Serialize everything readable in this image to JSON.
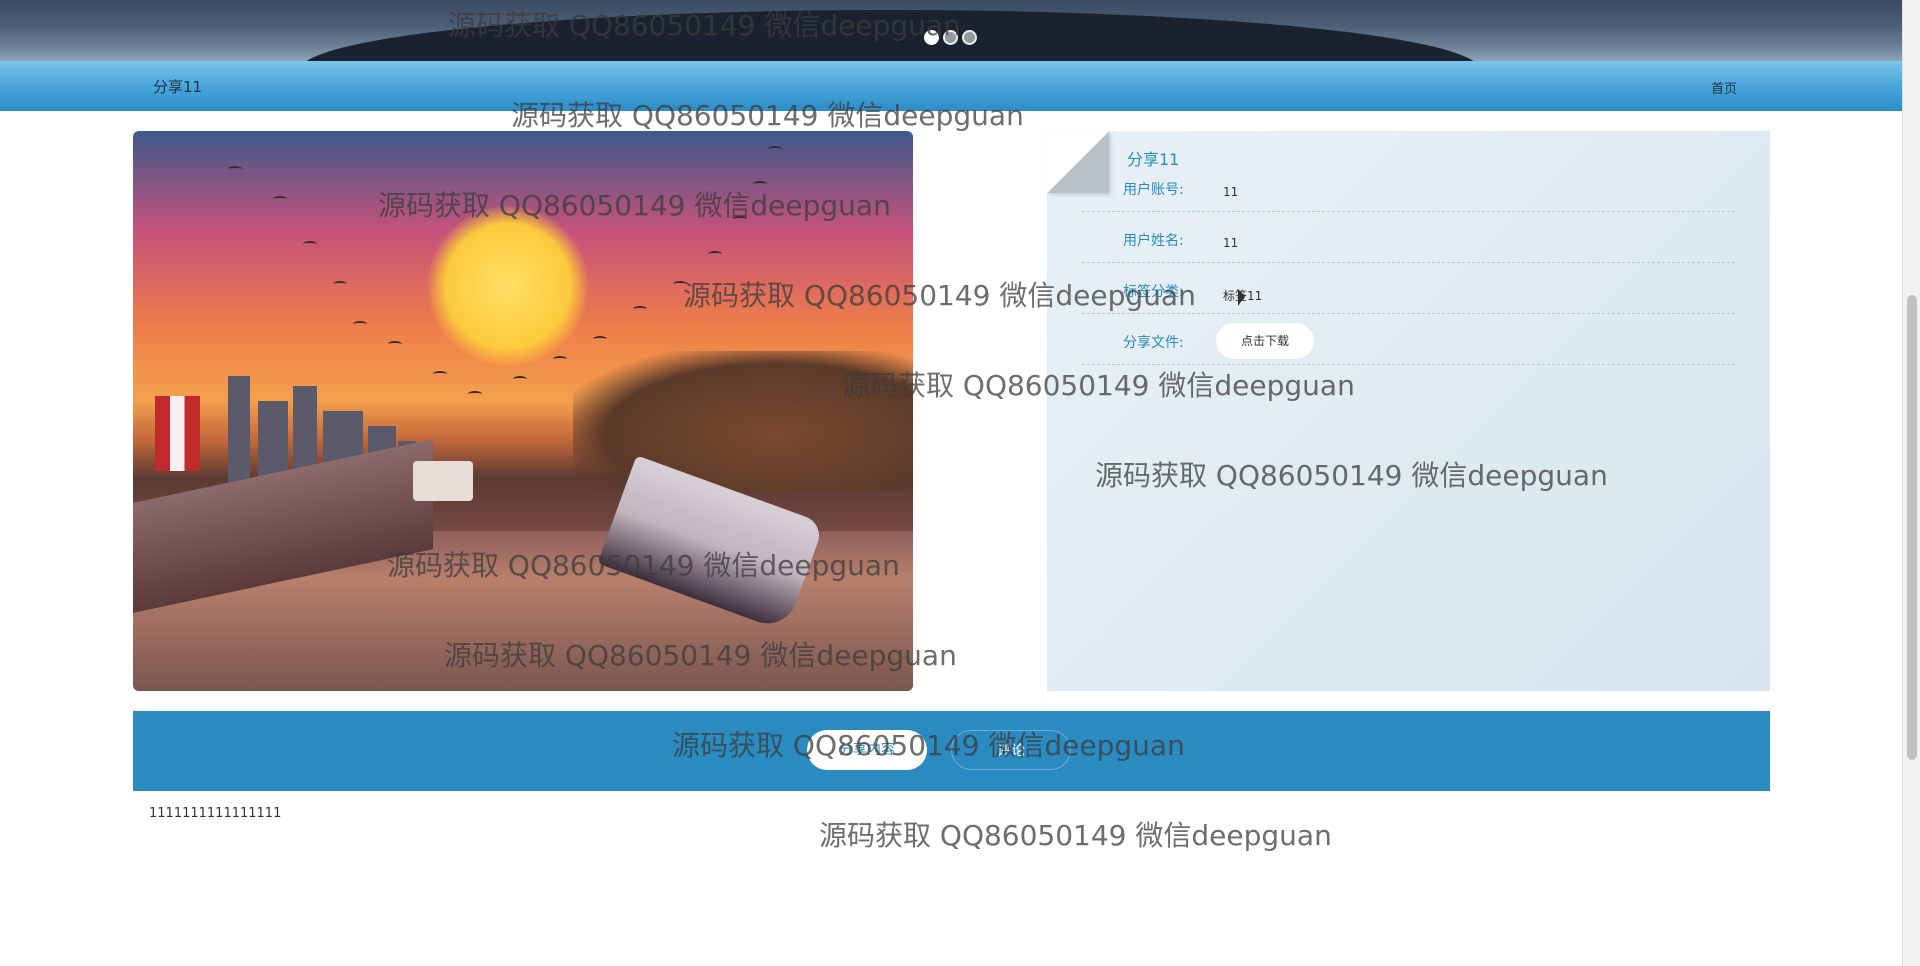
{
  "banner": {
    "slides": 3,
    "active_slide": 1
  },
  "navbar": {
    "brand": "分享11",
    "home_link": "首页"
  },
  "info_panel": {
    "title": "分享11",
    "fields": [
      {
        "label": "用户账号:",
        "value": "11"
      },
      {
        "label": "用户姓名:",
        "value": "11"
      },
      {
        "label": "标签分类:",
        "value": "标签11"
      },
      {
        "label": "分享文件:",
        "value": ""
      }
    ],
    "download_button": "点击下载"
  },
  "tabs": [
    {
      "label": "分享内容",
      "active": true
    },
    {
      "label": "评论",
      "active": false
    }
  ],
  "content": {
    "text": "1111111111111111"
  },
  "watermark": "源码获取 QQ86050149 微信deepguan",
  "colors": {
    "accent": "#2a8bc1",
    "navbar_top": "#7ec4ea",
    "navbar_bottom": "#2d8cc8",
    "panel_bg": "#dde9f1"
  }
}
